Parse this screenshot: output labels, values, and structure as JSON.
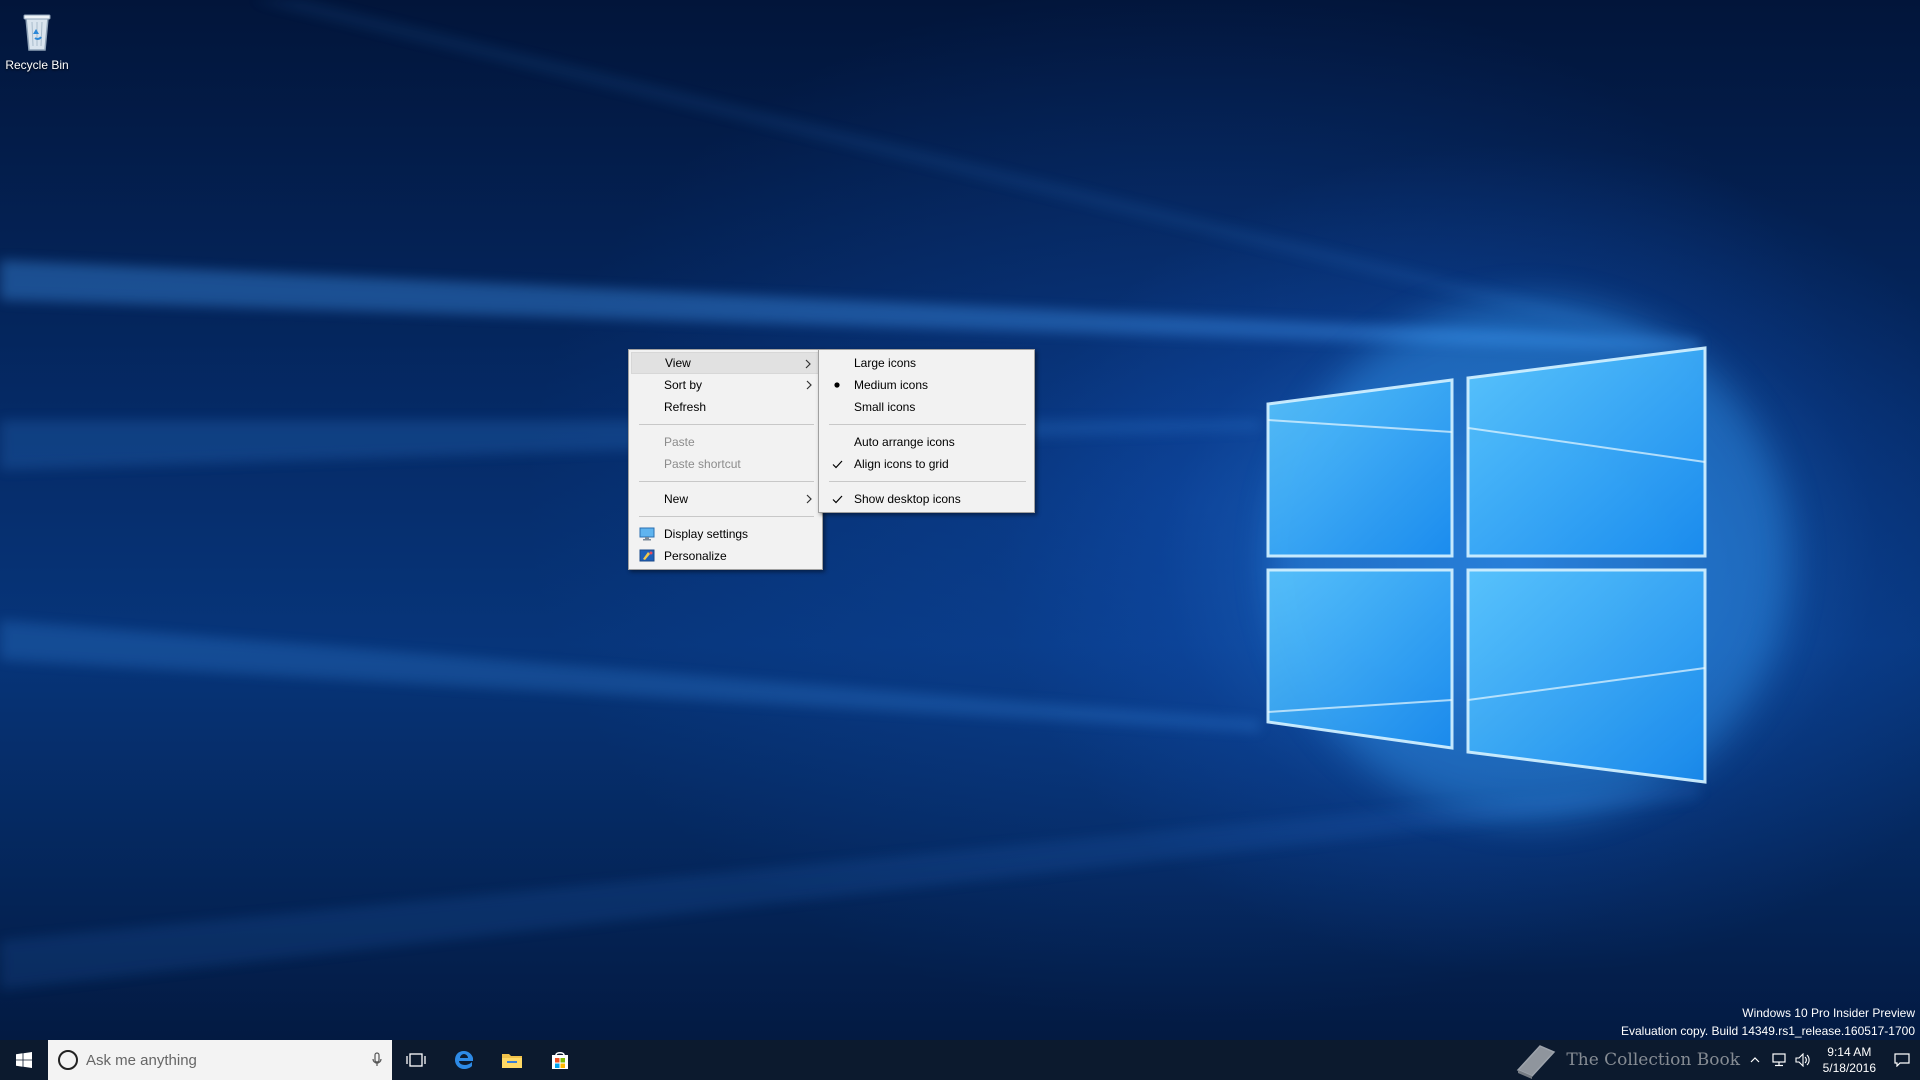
{
  "desktop": {
    "icons": [
      {
        "label": "Recycle Bin",
        "icon": "recycle-bin-icon"
      }
    ]
  },
  "context_menu": {
    "items": [
      {
        "label": "View",
        "submenu": true,
        "highlighted": true
      },
      {
        "label": "Sort by",
        "submenu": true
      },
      {
        "label": "Refresh"
      },
      {
        "separator": true
      },
      {
        "label": "Paste",
        "disabled": true
      },
      {
        "label": "Paste shortcut",
        "disabled": true
      },
      {
        "separator": true
      },
      {
        "label": "New",
        "submenu": true
      },
      {
        "separator": true
      },
      {
        "label": "Display settings",
        "icon": "display-settings-icon"
      },
      {
        "label": "Personalize",
        "icon": "personalize-icon"
      }
    ]
  },
  "view_submenu": {
    "items": [
      {
        "label": "Large icons"
      },
      {
        "label": "Medium icons",
        "marker": "bullet"
      },
      {
        "label": "Small icons"
      },
      {
        "separator": true
      },
      {
        "label": "Auto arrange icons"
      },
      {
        "label": "Align icons to grid",
        "marker": "check"
      },
      {
        "separator": true
      },
      {
        "label": "Show desktop icons",
        "marker": "check"
      }
    ]
  },
  "watermark": {
    "line1": "Windows 10 Pro Insider Preview",
    "line2": "Evaluation copy. Build 14349.rs1_release.160517-1700"
  },
  "taskbar": {
    "search_placeholder": "Ask me anything",
    "pinned": [
      "task-view-icon",
      "edge-icon",
      "file-explorer-icon",
      "store-icon"
    ],
    "brand_text": "The Collection Book",
    "clock_time": "9:14 AM",
    "clock_date": "5/18/2016"
  },
  "colors": {
    "taskbar": "#0c1a2e",
    "menu_bg": "#f2f2f2",
    "accent": "#0078d7"
  }
}
